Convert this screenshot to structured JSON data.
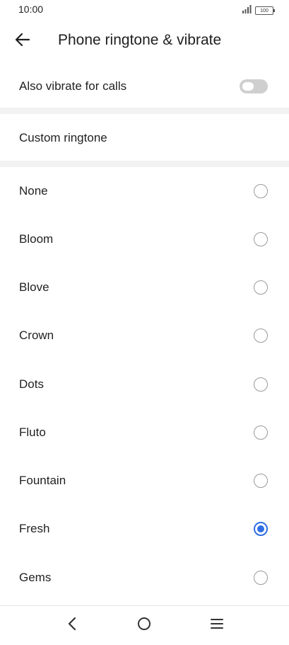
{
  "status_bar": {
    "time": "10:00",
    "battery": "100",
    "signal_icon": "signal-icon",
    "battery_icon": "battery-icon"
  },
  "header": {
    "title": "Phone ringtone & vibrate",
    "back_icon": "arrow-left-icon"
  },
  "settings": {
    "vibrate_label": "Also vibrate for calls",
    "vibrate_enabled": false,
    "custom_ringtone_label": "Custom ringtone"
  },
  "ringtones": [
    {
      "label": "None",
      "selected": false
    },
    {
      "label": "Bloom",
      "selected": false
    },
    {
      "label": "Blove",
      "selected": false
    },
    {
      "label": "Crown",
      "selected": false
    },
    {
      "label": "Dots",
      "selected": false
    },
    {
      "label": "Fluto",
      "selected": false
    },
    {
      "label": "Fountain",
      "selected": false
    },
    {
      "label": "Fresh",
      "selected": true
    },
    {
      "label": "Gems",
      "selected": false
    }
  ],
  "nav": {
    "back_icon": "chevron-left-icon",
    "home_icon": "circle-home-icon",
    "menu_icon": "menu-icon"
  },
  "colors": {
    "accent": "#2f6fe3",
    "toggle_off": "#cfcfcf",
    "band": "#f2f2f2"
  }
}
